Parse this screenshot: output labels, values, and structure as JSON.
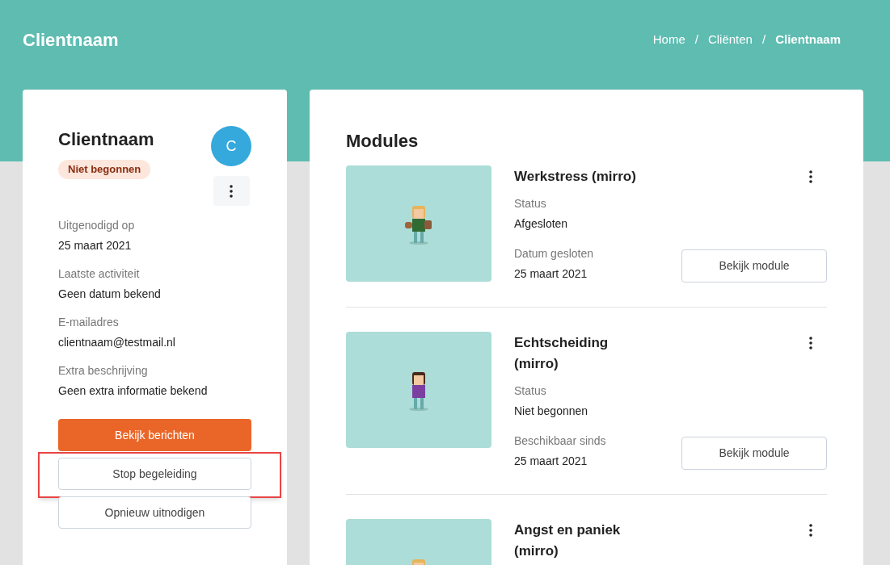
{
  "header": {
    "title": "Clientnaam",
    "separator": "/",
    "breadcrumbs": [
      {
        "label": "Home",
        "current": false
      },
      {
        "label": "Cliënten",
        "current": false
      },
      {
        "label": "Clientnaam",
        "current": true
      }
    ]
  },
  "client": {
    "name": "Clientnaam",
    "status_badge": "Niet begonnen",
    "avatar": "C",
    "details": [
      {
        "label": "Uitgenodigd op",
        "value": "25 maart 2021"
      },
      {
        "label": "Laatste activiteit",
        "value": "Geen datum bekend"
      },
      {
        "label": "E-mailadres",
        "value": "clientnaam@testmail.nl"
      },
      {
        "label": "Extra beschrijving",
        "value": "Geen extra informatie bekend"
      }
    ],
    "actions": [
      {
        "label": "Bekijk berichten",
        "kind": "primary",
        "highlighted": false
      },
      {
        "label": "Stop begeleiding",
        "kind": "secondary",
        "highlighted": true
      },
      {
        "label": "Opnieuw uitnodigen",
        "kind": "secondary",
        "highlighted": false
      }
    ]
  },
  "modules": {
    "title": "Modules",
    "items": [
      {
        "title": "Werkstress (mirro)",
        "image": {
          "kind": "picture"
        },
        "fields": [
          {
            "label": "Status",
            "value": "Afgesloten"
          },
          {
            "label": "Datum gesloten",
            "value": "25 maart 2021"
          }
        ],
        "button": "Bekijk module"
      },
      {
        "title": "Echtscheiding (mirro)",
        "image": {
          "kind": "picture"
        },
        "fields": [
          {
            "label": "Status",
            "value": "Niet begonnen"
          },
          {
            "label": "Beschikbaar sinds",
            "value": "25 maart 2021"
          }
        ],
        "button": "Bekijk module"
      },
      {
        "title": "Angst en paniek (mirro)",
        "image": {
          "kind": "picture"
        }
      }
    ]
  }
}
